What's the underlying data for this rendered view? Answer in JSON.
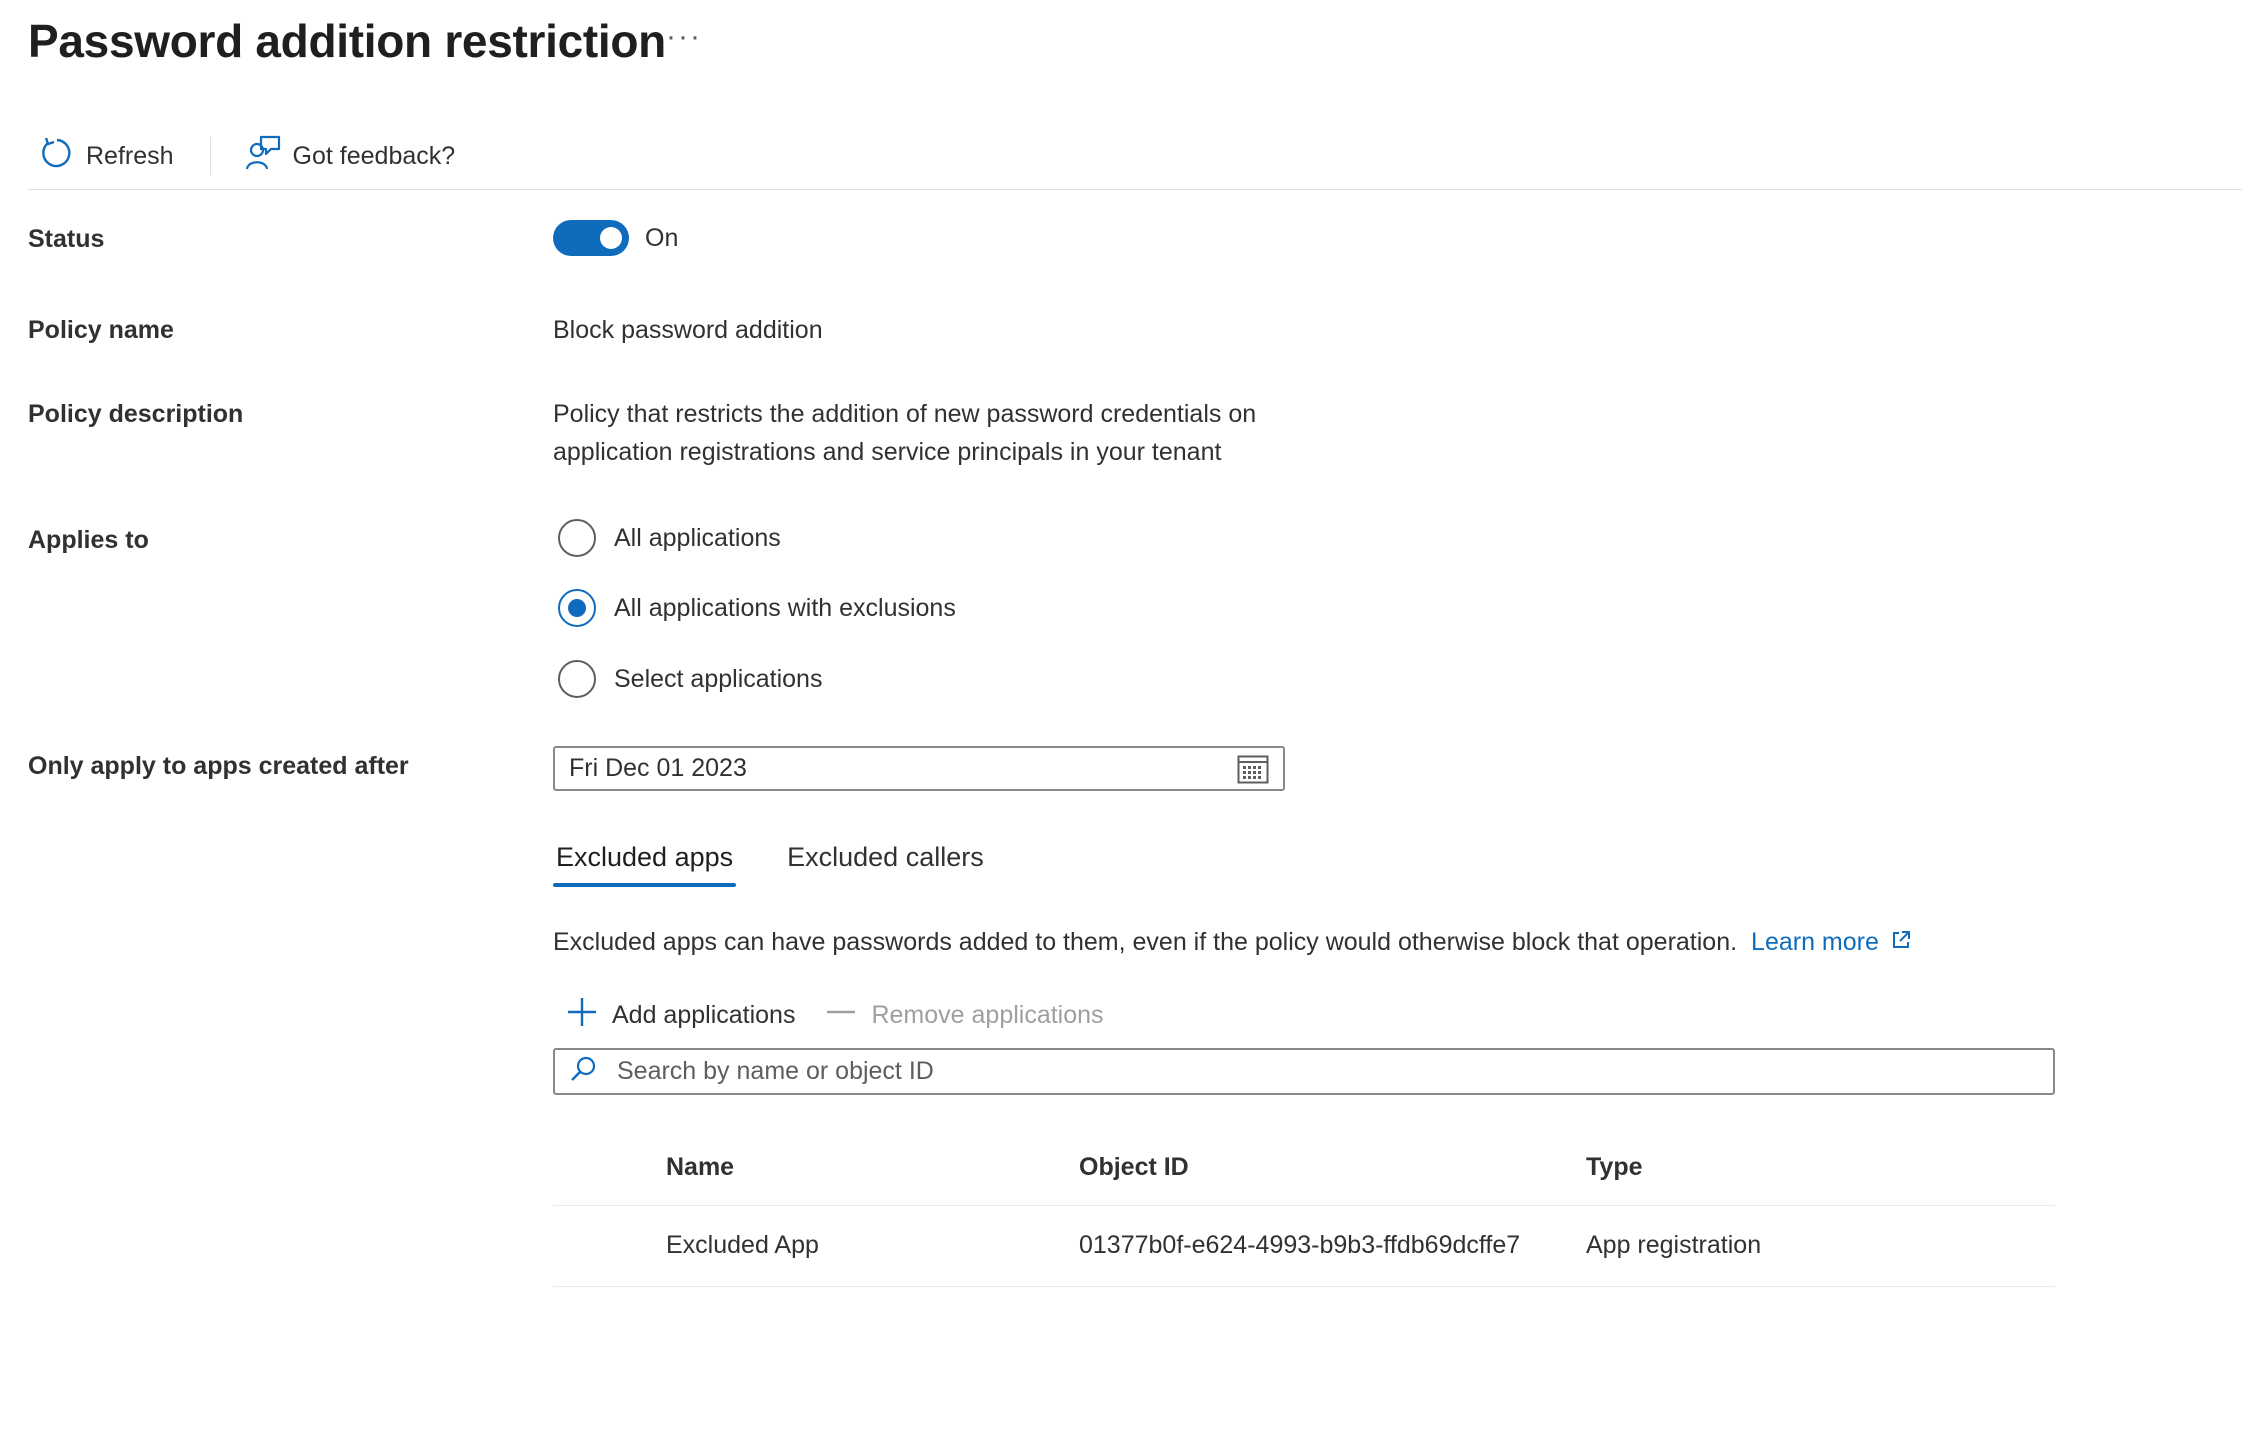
{
  "header": {
    "title": "Password addition restriction",
    "more_label": "···"
  },
  "toolbar": {
    "refresh_label": "Refresh",
    "feedback_label": "Got feedback?"
  },
  "form": {
    "status": {
      "label": "Status",
      "state": "On",
      "enabled": true
    },
    "policy_name": {
      "label": "Policy name",
      "value": "Block password addition"
    },
    "policy_description": {
      "label": "Policy description",
      "line1": "Policy that restricts the addition of new password credentials on",
      "line2": "application registrations and service principals in your tenant"
    },
    "applies_to": {
      "label": "Applies to",
      "options": [
        {
          "label": "All applications",
          "checked": false
        },
        {
          "label": "All applications with exclusions",
          "checked": true
        },
        {
          "label": "Select applications",
          "checked": false
        }
      ]
    },
    "created_after": {
      "label": "Only apply to apps created after",
      "value": "Fri Dec 01 2023"
    }
  },
  "tabs": [
    {
      "label": "Excluded apps",
      "active": true
    },
    {
      "label": "Excluded callers",
      "active": false
    }
  ],
  "excluded_apps": {
    "info_text": "Excluded apps can have passwords added to them, even if the policy would otherwise block that operation.",
    "learn_more": "Learn more",
    "add_label": "Add applications",
    "remove_label": "Remove applications",
    "search_placeholder": "Search by name or object ID",
    "columns": [
      "Name",
      "Object ID",
      "Type"
    ],
    "rows": [
      {
        "name": "Excluded App",
        "object_id": "01377b0f-e624-4993-b9b3-ffdb69dcffe7",
        "type": "App registration"
      }
    ]
  },
  "colors": {
    "accent": "#0f6cbd",
    "text": "#323130",
    "disabled": "#a19f9d",
    "divider": "#e1dfdd"
  }
}
